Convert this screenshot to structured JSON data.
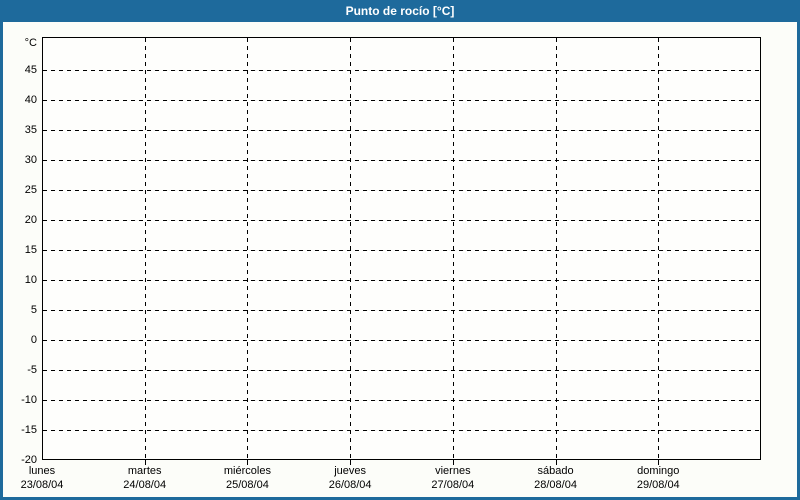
{
  "window": {
    "title": "Punto de rocío [°C]"
  },
  "colors": {
    "frame": "#1e6a9c",
    "title_text": "#ffffff",
    "panel_bg": "#fcfdf9",
    "plot_bg": "#fefefc",
    "line": "#000000",
    "label": "#000000"
  },
  "chart_data": {
    "type": "line",
    "title": "Punto de rocío [°C]",
    "unit_label": "°C",
    "x_categories": [
      {
        "day": "lunes",
        "date": "23/08/04"
      },
      {
        "day": "martes",
        "date": "24/08/04"
      },
      {
        "day": "miércoles",
        "date": "25/08/04"
      },
      {
        "day": "jueves",
        "date": "26/08/04"
      },
      {
        "day": "viernes",
        "date": "27/08/04"
      },
      {
        "day": "sábado",
        "date": "28/08/04"
      },
      {
        "day": "domingo",
        "date": "29/08/04"
      }
    ],
    "y_ticks": [
      45,
      40,
      35,
      30,
      25,
      20,
      15,
      10,
      5,
      0,
      -5,
      -10,
      -15,
      -20
    ],
    "ylim": [
      -20,
      50
    ],
    "grid": "dashed",
    "legend": "none",
    "series": []
  }
}
